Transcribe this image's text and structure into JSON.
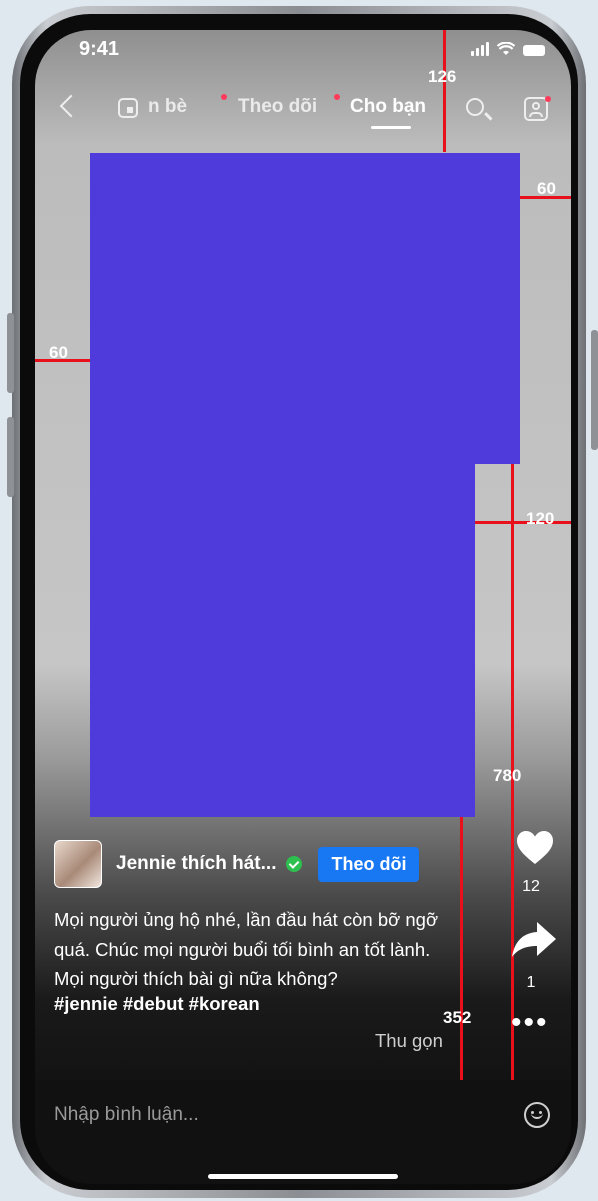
{
  "status_bar": {
    "time": "9:41"
  },
  "nav": {
    "tabs": [
      {
        "label": "n bè"
      },
      {
        "label": "Theo dõi"
      },
      {
        "label": "Cho bạn"
      }
    ]
  },
  "measurements": [
    "126",
    "60",
    "60",
    "120",
    "780",
    "352"
  ],
  "creator": {
    "name": "Jennie thích hát...",
    "follow_label": "Theo dõi"
  },
  "caption": {
    "text": "Mọi người ủng hộ nhé, lần đầu hát còn bỡ ngỡ quá. Chúc mọi người buổi tối bình an tốt lành. Mọi người thích bài gì nữa không?",
    "hashtags": "#jennie #debut #korean",
    "collapse_label": "Thu gọn"
  },
  "actions": {
    "likes": "12",
    "shares": "1"
  },
  "comment": {
    "placeholder": "Nhập bình luận..."
  },
  "colors": {
    "video_placeholder": "#4f3adb",
    "follow_button": "#1877f2",
    "guide_line": "#e8101a",
    "notification_dot": "#ff3b5c"
  }
}
